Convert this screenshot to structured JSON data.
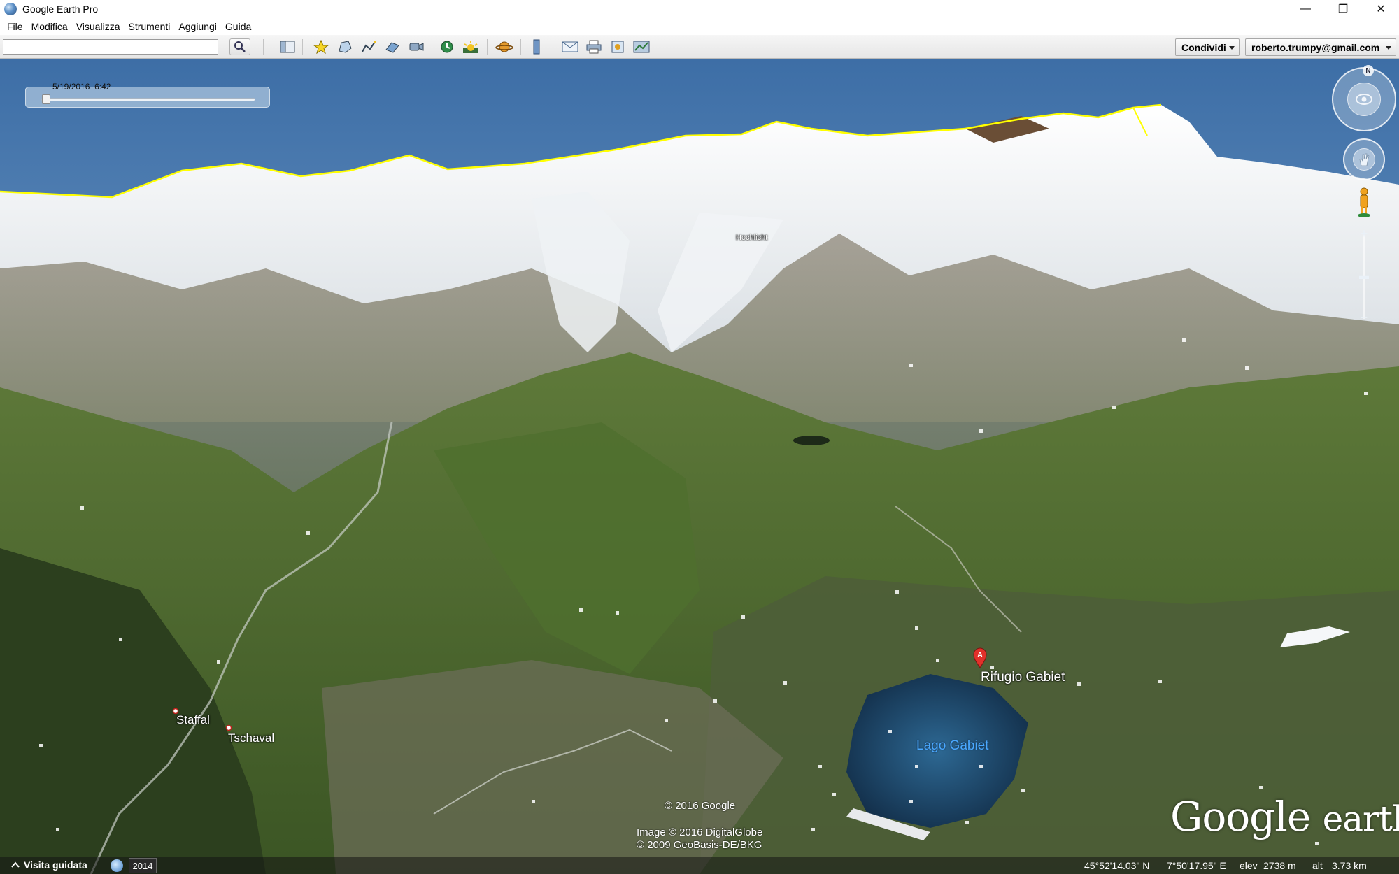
{
  "window": {
    "title": "Google Earth Pro",
    "controls": {
      "minimize": "—",
      "restore": "❐",
      "close": "✕"
    }
  },
  "menu": [
    "File",
    "Modifica",
    "Visualizza",
    "Strumenti",
    "Aggiungi",
    "Guida"
  ],
  "toolbar": {
    "search_value": "",
    "buttons": [
      "search-icon",
      "sidebar-toggle-icon",
      "placemark-icon",
      "polygon-icon",
      "path-icon",
      "overlay-icon",
      "record-tour-icon",
      "historical-imagery-icon",
      "sunlight-icon",
      "planets-icon",
      "ruler-icon",
      "email-icon",
      "print-icon",
      "save-image-icon",
      "view-in-maps-icon"
    ],
    "share_label": "Condividi",
    "account_label": "roberto.trumpy@gmail.com"
  },
  "time_slider": {
    "date": "5/19/2016",
    "time": "6:42",
    "position": 0
  },
  "navigation": {
    "north": "N",
    "zoom_in": "+",
    "zoom_out": "−"
  },
  "map": {
    "places": [
      {
        "name": "Rifugio Gabiet"
      },
      {
        "name": "Staffal"
      },
      {
        "name": "Tschaval"
      }
    ],
    "lake": "Lago Gabiet",
    "peak_label": "Hochlicht",
    "marker_letter": "A",
    "colors": {
      "sky_top": "#5a86b8",
      "snow": "#f3f5f7",
      "grass": "#4d6a2d",
      "lake": "#173a5c",
      "ridge_line": "#ffff00"
    }
  },
  "credits": {
    "google": "© 2016 Google",
    "image": "Image © 2016 DigitalGlobe",
    "geobasis": "© 2009 GeoBasis-DE/BKG"
  },
  "logo": {
    "word1": "Google",
    "word2": "earth"
  },
  "status": {
    "tour_label": "Visita guidata",
    "year": "2014",
    "lat": "45°52'14.03\" N",
    "lon": "7°50'17.95\" E",
    "elev_label": "elev",
    "elev": "2738 m",
    "alt_label": "alt",
    "alt": "3.73 km"
  }
}
